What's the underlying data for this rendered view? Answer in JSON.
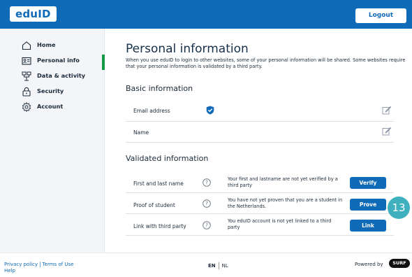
{
  "header": {
    "logo_text": "edu",
    "logo_accent": "ID",
    "logout_label": "Logout"
  },
  "sidebar": {
    "items": [
      {
        "label": "Home",
        "icon": "home-icon"
      },
      {
        "label": "Personal info",
        "icon": "id-card-icon",
        "active": true
      },
      {
        "label": "Data & activity",
        "icon": "data-activity-icon"
      },
      {
        "label": "Security",
        "icon": "lock-icon"
      },
      {
        "label": "Account",
        "icon": "gear-icon"
      }
    ]
  },
  "main": {
    "title": "Personal information",
    "intro": "When you use eduID to login to other websites, some of your personal information will be shared. Some websites require that your personal information is validated by a third party.",
    "basic": {
      "title": "Basic information",
      "rows": [
        {
          "label": "Email address"
        },
        {
          "label": "Name"
        }
      ]
    },
    "validated": {
      "title": "Validated information",
      "rows": [
        {
          "label": "First and last name",
          "desc": "Your first and lastname are not yet verified by a third party",
          "button": "Verify"
        },
        {
          "label": "Proof of student",
          "desc": "You have not yet proven that you are a student in the Netherlands.",
          "button": "Prove"
        },
        {
          "label": "Link with third party",
          "desc": "You eduID account is not yet linked to a third party",
          "button": "Link"
        }
      ]
    },
    "step_badge": "13"
  },
  "footer": {
    "privacy": "Privacy policy",
    "separator": "|",
    "terms": "Terms of Use",
    "help": "Help",
    "lang_en": "EN",
    "lang_nl": "NL",
    "powered_by": "Powered by",
    "surf": "SURF"
  },
  "colors": {
    "brand_blue": "#0f6ab7",
    "active_green": "#159b45",
    "badge_teal": "#3fb1be"
  }
}
